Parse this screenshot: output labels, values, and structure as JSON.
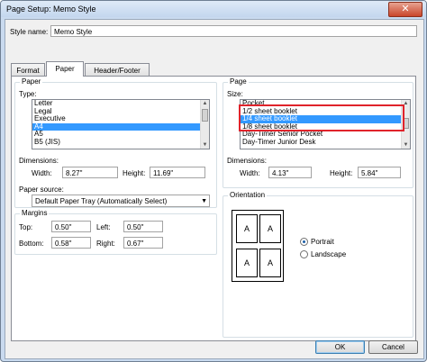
{
  "window": {
    "title": "Page Setup: Memo Style",
    "close_label": "✕"
  },
  "style_name": {
    "label": "Style name:",
    "value": "Memo Style"
  },
  "tabs": [
    {
      "label": "Format",
      "active": false
    },
    {
      "label": "Paper",
      "active": true
    },
    {
      "label": "Header/Footer",
      "active": false
    }
  ],
  "paper": {
    "group_title": "Paper",
    "type_label": "Type:",
    "types": [
      {
        "label": "Letter",
        "selected": false
      },
      {
        "label": "Legal",
        "selected": false
      },
      {
        "label": "Executive",
        "selected": false
      },
      {
        "label": "A4",
        "selected": true
      },
      {
        "label": "A5",
        "selected": false
      },
      {
        "label": "B5 (JIS)",
        "selected": false
      }
    ],
    "dimensions_label": "Dimensions:",
    "width_label": "Width:",
    "width_value": "8.27\"",
    "height_label": "Height:",
    "height_value": "11.69\"",
    "source_label": "Paper source:",
    "source_value": "Default Paper Tray (Automatically Select)"
  },
  "margins": {
    "group_title": "Margins",
    "top_label": "Top:",
    "top_value": "0.50\"",
    "left_label": "Left:",
    "left_value": "0.50\"",
    "bottom_label": "Bottom:",
    "bottom_value": "0.58\"",
    "right_label": "Right:",
    "right_value": "0.67\""
  },
  "page": {
    "group_title": "Page",
    "size_label": "Size:",
    "sizes": [
      {
        "label": "Pocket",
        "selected": false
      },
      {
        "label": "1/2 sheet booklet",
        "selected": false
      },
      {
        "label": "1/4 sheet booklet",
        "selected": true
      },
      {
        "label": "1/8 sheet booklet",
        "selected": false
      },
      {
        "label": "Day-Timer Senior Pocket",
        "selected": false
      },
      {
        "label": "Day-Timer Junior Desk",
        "selected": false
      }
    ],
    "dimensions_label": "Dimensions:",
    "width_label": "Width:",
    "width_value": "4.13\"",
    "height_label": "Height:",
    "height_value": "5.84\""
  },
  "orientation": {
    "group_title": "Orientation",
    "preview_letters": [
      "A",
      "A",
      "A",
      "A"
    ],
    "portrait_label": "Portrait",
    "landscape_label": "Landscape",
    "selected": "portrait"
  },
  "buttons": {
    "ok_label": "OK",
    "cancel_label": "Cancel"
  }
}
